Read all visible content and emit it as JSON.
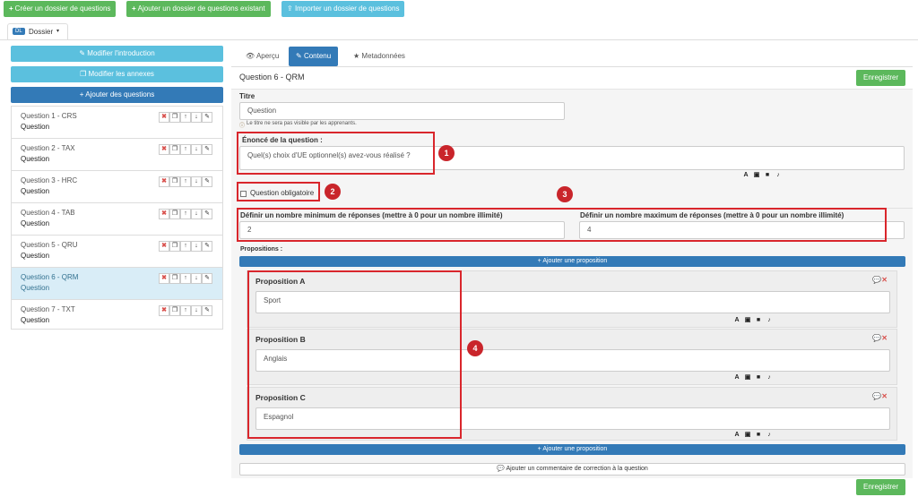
{
  "toolbar": {
    "create": "Créer un dossier de questions",
    "add_existing": "Ajouter un dossier de questions existant",
    "import": "Importer un dossier de questions"
  },
  "folder": {
    "badge": "DL",
    "label": "Dossier"
  },
  "sidebar": {
    "edit_intro": "Modifier l'introduction",
    "edit_annexes": "Modifier les annexes",
    "add_questions": "Ajouter des questions",
    "questions": [
      {
        "title": "Question 1 - CRS",
        "sub": "Question"
      },
      {
        "title": "Question 2 - TAX",
        "sub": "Question"
      },
      {
        "title": "Question 3 - HRC",
        "sub": "Question"
      },
      {
        "title": "Question 4 - TAB",
        "sub": "Question"
      },
      {
        "title": "Question 5 - QRU",
        "sub": "Question"
      },
      {
        "title": "Question 6 - QRM",
        "sub": "Question"
      },
      {
        "title": "Question 7 - TXT",
        "sub": "Question"
      }
    ]
  },
  "tabs": {
    "preview": "Aperçu",
    "content": "Contenu",
    "metadata": "Metadonnées"
  },
  "main": {
    "heading": "Question 6 - QRM",
    "save": "Enregistrer",
    "title_label": "Titre",
    "title_value": "Question",
    "title_hint": "Le titre ne sera pas visible par les apprenants.",
    "statement_label": "Énoncé de la question :",
    "statement_value": "Quel(s) choix d'UE optionnel(s) avez-vous réalisé ?",
    "mandatory_label": "Question obligatoire",
    "min_label": "Définir un nombre minimum de réponses (mettre à 0 pour un nombre illimité)",
    "min_value": "2",
    "max_label": "Définir un nombre maximum de réponses (mettre à 0 pour un nombre illimité)",
    "max_value": "4",
    "propositions_label": "Propositions :",
    "add_proposition": "Ajouter une proposition",
    "propositions": [
      {
        "title": "Proposition A",
        "value": "Sport"
      },
      {
        "title": "Proposition B",
        "value": "Anglais"
      },
      {
        "title": "Proposition C",
        "value": "Espagnol"
      }
    ],
    "comment": "Ajouter un commentaire de correction à la question",
    "save_bottom": "Enregistrer"
  },
  "annotations": [
    "1",
    "2",
    "3",
    "4"
  ],
  "colors": {
    "primary": "#337ab7",
    "success": "#5cb85c",
    "info": "#5bc0de",
    "annotation": "#c9252b"
  }
}
